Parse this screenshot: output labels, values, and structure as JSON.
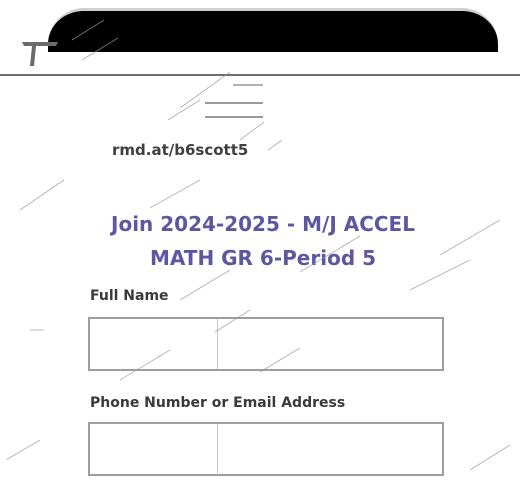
{
  "join": {
    "link": "rmd.at/b6scott5",
    "title_line1": "Join 2024-2025 - M/J ACCEL",
    "title_line2": "MATH GR 6-Period 5"
  },
  "form": {
    "full_name_label": "Full Name",
    "full_name_value": "",
    "contact_label": "Phone Number or Email Address",
    "contact_value": ""
  },
  "colors": {
    "title": "#5b57a6",
    "text": "#3f3f3f",
    "field_border": "#9e9e9e",
    "top_bar": "#000000"
  },
  "icons": {
    "logo": "remind-logo-icon"
  }
}
